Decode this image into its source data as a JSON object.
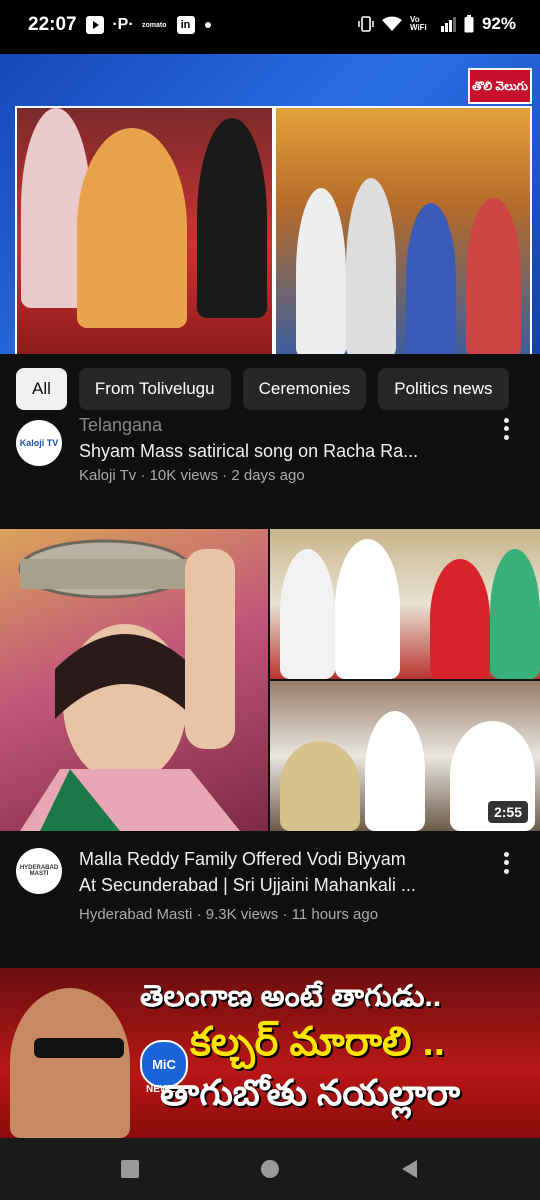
{
  "status_bar": {
    "time": "22:07",
    "notif_zomato": "zomato",
    "notif_linkedin": "in",
    "network": "Vo WiFi",
    "battery": "92%"
  },
  "hero": {
    "channel_logo": "తొలి వెలుగు"
  },
  "chips": [
    "All",
    "From Tolivelugu",
    "Ceremonies",
    "Politics news"
  ],
  "videos": [
    {
      "title_line1": "Telangana",
      "title_line2": "Shyam Mass satirical song on Racha Ra...",
      "channel": "Kaloji Tv",
      "views": "10K views",
      "age": "2 days ago",
      "avatar_text": "Kaloji TV"
    },
    {
      "duration": "2:55",
      "title_line1": "Malla Reddy Family Offered Vodi Biyyam",
      "title_line2": "At Secunderabad | Sri Ujjaini Mahankali ...",
      "channel": "Hyderabad Masti",
      "views": "9.3K views",
      "age": "11 hours ago",
      "avatar_text": "HYDERABAD MASTI"
    },
    {
      "headline_1": "తెలంగాణ అంటే తాగుడు..",
      "headline_2": "కల్చర్ మారాలి ..",
      "headline_3": "తాగుబోతు నయల్లారా",
      "logo": "MiC",
      "logo_sub": "NEWS"
    }
  ],
  "colors": {
    "background": "#0f0f0f",
    "chip_active": "#f1f1f1",
    "chip": "#272727",
    "meta_text": "#aaaaaa"
  }
}
